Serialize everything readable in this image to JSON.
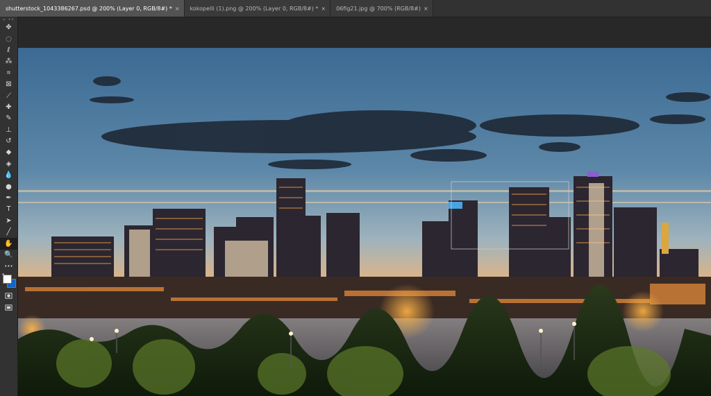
{
  "tabs": [
    {
      "label": "shutterstock_1043386267.psd @ 200% (Layer 0, RGB/8#) *",
      "close": "×",
      "active": true
    },
    {
      "label": "kokopelli (1).png @ 200% (Layer 0, RGB/8#) *",
      "close": "×",
      "active": false
    },
    {
      "label": "06fig21.jpg @ 700% (RGB/8#)",
      "close": "×",
      "active": false
    }
  ],
  "toolbar": {
    "grip": "» ••",
    "more_label": "•••",
    "tools": [
      {
        "name": "move-tool",
        "glyph": "✥"
      },
      {
        "name": "elliptical-marquee-tool",
        "glyph": "◌"
      },
      {
        "name": "lasso-tool",
        "glyph": "ℓ"
      },
      {
        "name": "quick-selection-tool",
        "glyph": "⁂"
      },
      {
        "name": "crop-tool",
        "glyph": "⌗"
      },
      {
        "name": "frame-tool",
        "glyph": "⊠"
      },
      {
        "name": "eyedropper-tool",
        "glyph": "⟋"
      },
      {
        "name": "spot-healing-brush-tool",
        "glyph": "✚"
      },
      {
        "name": "brush-tool",
        "glyph": "✎"
      },
      {
        "name": "clone-stamp-tool",
        "glyph": "⊥"
      },
      {
        "name": "history-brush-tool",
        "glyph": "↺"
      },
      {
        "name": "eraser-tool",
        "glyph": "◆"
      },
      {
        "name": "paint-bucket-tool",
        "glyph": "◈"
      },
      {
        "name": "blur-tool",
        "glyph": "💧"
      },
      {
        "name": "dodge-tool",
        "glyph": "●"
      },
      {
        "name": "pen-tool",
        "glyph": "✒"
      },
      {
        "name": "type-tool",
        "glyph": "T"
      },
      {
        "name": "path-selection-tool",
        "glyph": "➤"
      },
      {
        "name": "line-tool",
        "glyph": "╱"
      },
      {
        "name": "hand-tool",
        "glyph": "✋",
        "active": true
      },
      {
        "name": "zoom-tool",
        "glyph": "🔍"
      }
    ],
    "foreground_color": "#ffffff",
    "background_color": "#1565c0"
  },
  "colors": {
    "tab_active": "#535353",
    "panel": "#323232",
    "pasteboard": "#282828"
  }
}
